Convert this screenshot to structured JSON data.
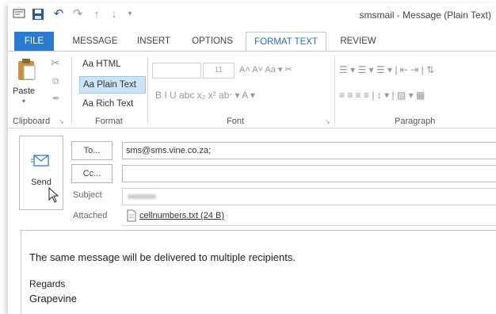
{
  "window": {
    "title": "smsmail - Message (Plain Text)"
  },
  "qat": {
    "items": [
      "app-icon",
      "save-icon",
      "undo-icon",
      "redo-icon",
      "up-arrow-icon",
      "down-arrow-icon",
      "customize-icon"
    ]
  },
  "tabs": [
    {
      "label": "FILE"
    },
    {
      "label": "MESSAGE"
    },
    {
      "label": "INSERT"
    },
    {
      "label": "OPTIONS"
    },
    {
      "label": "FORMAT TEXT"
    },
    {
      "label": "REVIEW"
    }
  ],
  "ribbon": {
    "clipboard": {
      "paste_label": "Paste",
      "group_label": "Clipboard"
    },
    "format": {
      "group_label": "Format",
      "html": "Aa HTML",
      "plain": "Aa Plain Text",
      "rich": "Aa Rich Text"
    },
    "font": {
      "group_label": "Font",
      "size": "11",
      "row1_buttons": "A˄ A˅   Aa ▾   ✂",
      "row2_buttons": "B   I   U   abc   x₂   x²   ab‧ ▾   A ▾"
    },
    "paragraph": {
      "group_label": "Paragraph",
      "row1": "☰ ▾  ☰ ▾  ☰ ▾  |  ⇤  ⇥  |  ⇅",
      "row2": "≡  ≡  ≡  ≡  |  ↕ ▾  |  ▨ ▾  ▦"
    },
    "accent": "#2b7bd1"
  },
  "form": {
    "send_label": "Send",
    "to_label": "To...",
    "to_value": "sms@sms.vine.co.za;",
    "cc_label": "Cc...",
    "cc_value": "",
    "subject_label": "Subject",
    "subject_value": "",
    "attached_label": "Attached",
    "attachment_name": "cellnumbers.txt (24 B)"
  },
  "message": {
    "line1": "The same message will be delivered to multiple recipients.",
    "line2": "Regards",
    "line3": "Grapevine"
  }
}
